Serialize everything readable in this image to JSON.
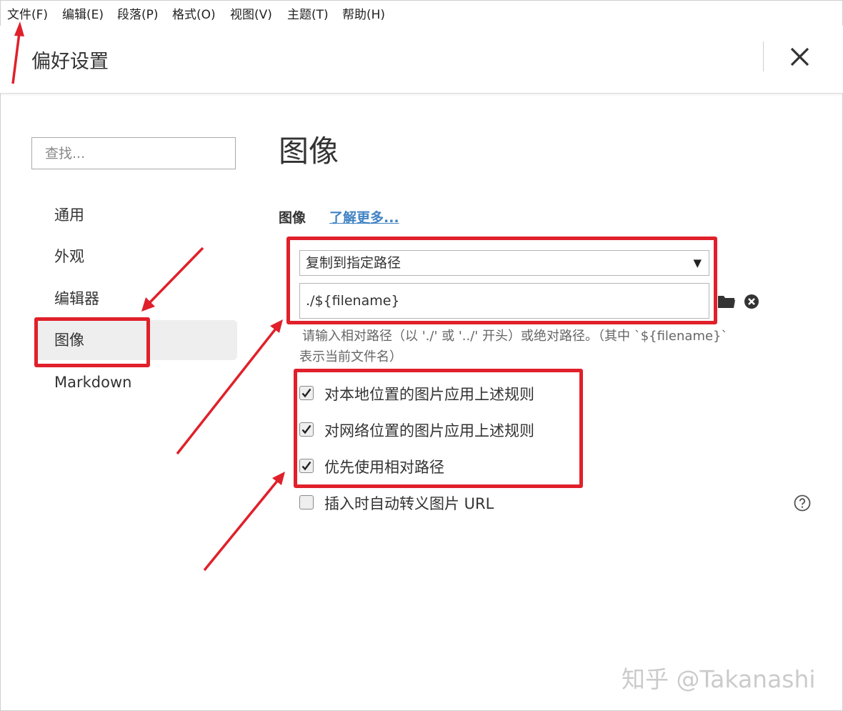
{
  "menubar": {
    "items": [
      "文件(F)",
      "编辑(E)",
      "段落(P)",
      "格式(O)",
      "视图(V)",
      "主题(T)",
      "帮助(H)"
    ]
  },
  "dialog": {
    "title": "偏好设置"
  },
  "sidebar": {
    "search_placeholder": "查找...",
    "items": [
      {
        "label": "通用",
        "active": false
      },
      {
        "label": "外观",
        "active": false
      },
      {
        "label": "编辑器",
        "active": false
      },
      {
        "label": "图像",
        "active": true
      },
      {
        "label": "Markdown",
        "active": false
      }
    ]
  },
  "main": {
    "section_title": "图像",
    "subsection_label": "图像",
    "learn_more": "了解更多...",
    "select_value": "复制到指定路径",
    "path_value": "./${filename}",
    "hint_line1": "请输入相对路径（以 './' 或 '../' 开头）或绝对路径。（其中 `${filename}`",
    "hint_line2": "表示当前文件名）",
    "checkboxes": [
      {
        "label": "对本地位置的图片应用上述规则",
        "checked": true
      },
      {
        "label": "对网络位置的图片应用上述规则",
        "checked": true
      },
      {
        "label": "优先使用相对路径",
        "checked": true
      },
      {
        "label": "插入时自动转义图片 URL",
        "checked": false
      }
    ]
  },
  "watermark": "知乎 @Takanashi",
  "colors": {
    "annotation_red": "#e0202a",
    "link_blue": "#4183c4",
    "active_nav_bg": "#eeeeee"
  }
}
